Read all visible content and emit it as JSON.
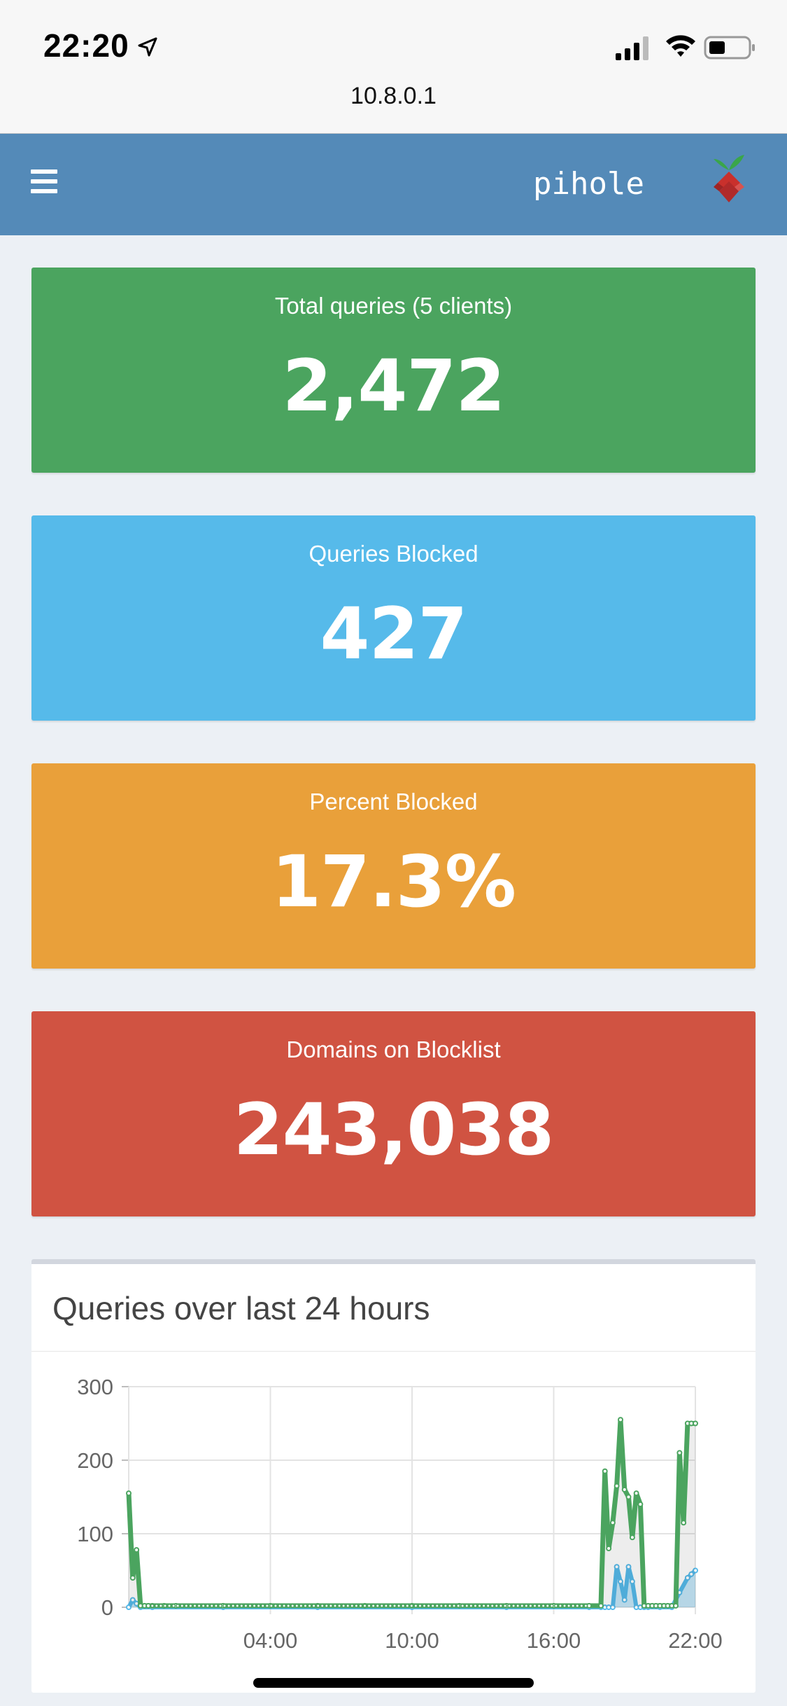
{
  "status_bar": {
    "time": "22:20",
    "icons": [
      "location-arrow-icon",
      "signal-bars-icon",
      "wifi-icon",
      "battery-icon"
    ]
  },
  "browser": {
    "url": "10.8.0.1"
  },
  "header": {
    "brand": "pihole",
    "menu_icon": "hamburger-icon",
    "logo": "pihole-logo"
  },
  "stats": [
    {
      "label": "Total queries (5 clients)",
      "value": "2,472",
      "color": "#4ba45f"
    },
    {
      "label": "Queries Blocked",
      "value": "427",
      "color": "#56baea"
    },
    {
      "label": "Percent Blocked",
      "value": "17.3%",
      "color": "#e9a03a"
    },
    {
      "label": "Domains on Blocklist",
      "value": "243,038",
      "color": "#d05342"
    }
  ],
  "panel": {
    "title": "Queries over last 24 hours"
  },
  "chart_data": {
    "type": "area",
    "title": "",
    "xlabel": "",
    "ylabel": "",
    "x_ticks": [
      "04:00",
      "10:00",
      "16:00",
      "22:00"
    ],
    "y_ticks": [
      0,
      100,
      200,
      300
    ],
    "ylim": [
      0,
      300
    ],
    "xlim_hours": [
      22.0,
      46.0
    ],
    "x_tick_hours": [
      28,
      34,
      40,
      46
    ],
    "grid": true,
    "series": [
      {
        "color": "#4ba45f",
        "x_hours": [
          22.0,
          22.17,
          22.33,
          22.5,
          22.67,
          22.83,
          23.0,
          23.5,
          24,
          26,
          28,
          30,
          32,
          34,
          36,
          38,
          40,
          41.5,
          42.0,
          42.17,
          42.33,
          42.5,
          42.67,
          42.83,
          43.0,
          43.17,
          43.33,
          43.5,
          43.67,
          43.83,
          44.0,
          44.17,
          44.33,
          44.5,
          44.67,
          44.83,
          45.0,
          45.17,
          45.33,
          45.5,
          45.67,
          45.83,
          46.0
        ],
        "values": [
          155,
          40,
          78,
          2,
          2,
          2,
          2,
          2,
          2,
          2,
          2,
          2,
          2,
          2,
          2,
          2,
          2,
          2,
          2,
          185,
          80,
          115,
          165,
          255,
          160,
          150,
          95,
          155,
          140,
          2,
          2,
          2,
          2,
          2,
          2,
          2,
          2,
          2,
          210,
          115,
          250,
          250,
          250
        ]
      },
      {
        "color": "#56baea",
        "x_hours": [
          22.0,
          22.17,
          22.33,
          22.5,
          23,
          26,
          30,
          34,
          38,
          41.5,
          42.0,
          42.17,
          42.33,
          42.5,
          42.67,
          42.83,
          43.0,
          43.17,
          43.33,
          43.5,
          43.67,
          43.83,
          44.0,
          44.5,
          45.0,
          45.33,
          45.67,
          45.83,
          46.0
        ],
        "values": [
          0,
          10,
          5,
          0,
          0,
          0,
          0,
          0,
          0,
          0,
          0,
          0,
          0,
          0,
          55,
          35,
          10,
          55,
          35,
          0,
          0,
          0,
          0,
          0,
          0,
          20,
          40,
          45,
          50
        ]
      }
    ]
  }
}
